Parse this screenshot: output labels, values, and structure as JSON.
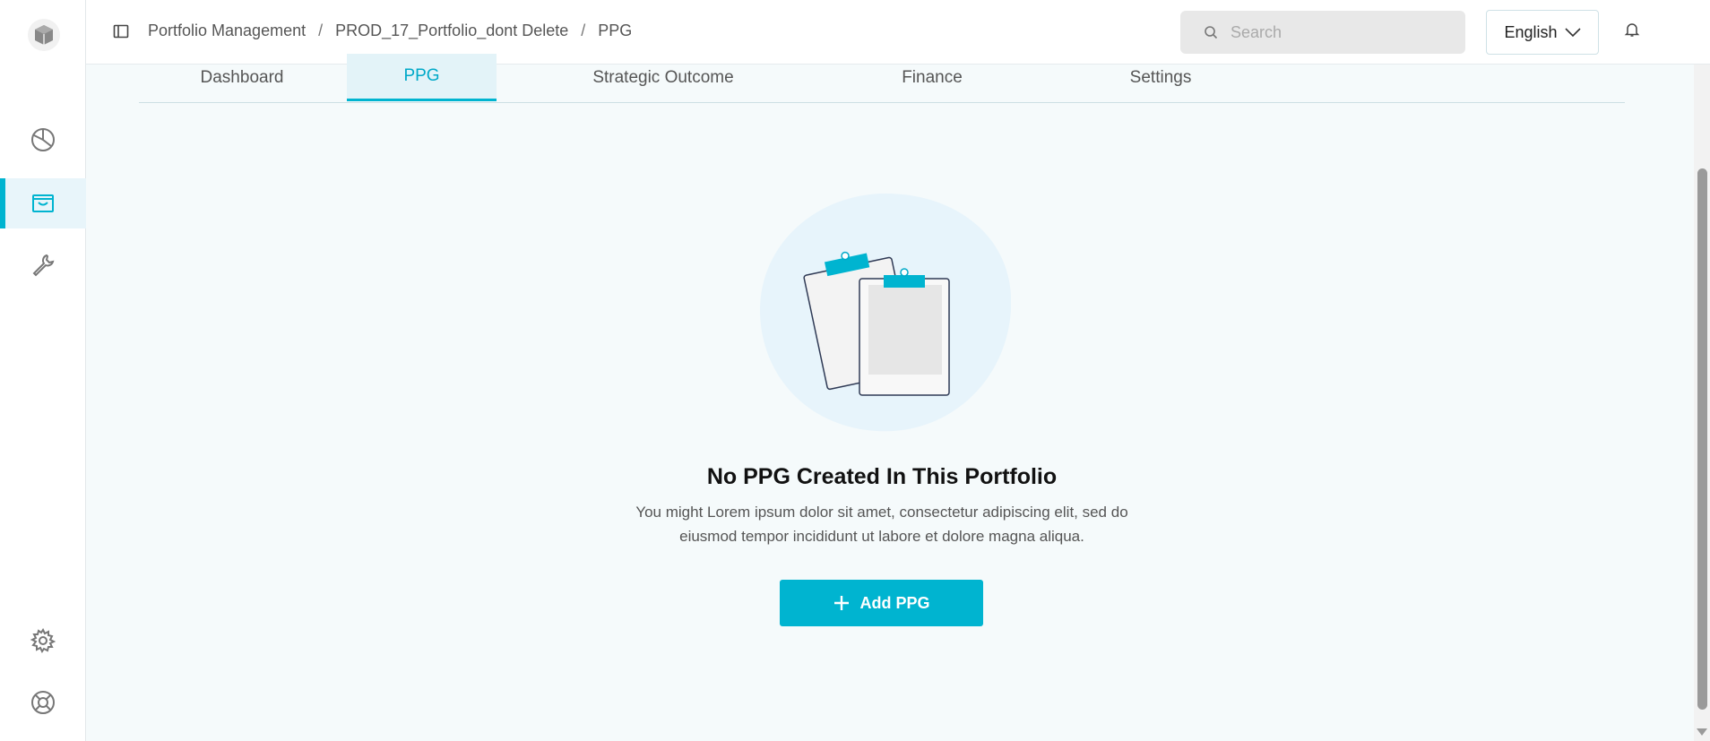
{
  "sidebar": {
    "logo_icon": "cube-logo-icon",
    "items": [
      {
        "icon": "pie-chart-icon",
        "active": false
      },
      {
        "icon": "inbox-icon",
        "active": true
      },
      {
        "icon": "wrench-icon",
        "active": false
      }
    ],
    "bottom_items": [
      {
        "icon": "gear-icon"
      },
      {
        "icon": "lifebuoy-icon"
      }
    ]
  },
  "topbar": {
    "breadcrumb": [
      "Portfolio Management",
      "PROD_17_Portfolio_dont Delete",
      "PPG"
    ],
    "breadcrumb_separator": "/",
    "search_placeholder": "Search",
    "language": "English"
  },
  "tabs": [
    {
      "label": "Dashboard",
      "active": false
    },
    {
      "label": "PPG",
      "active": true
    },
    {
      "label": "Strategic Outcome",
      "active": false
    },
    {
      "label": "Finance",
      "active": false
    },
    {
      "label": "Settings",
      "active": false
    }
  ],
  "empty_state": {
    "title": "No PPG Created In This Portfolio",
    "description": "You might Lorem ipsum dolor sit amet, consectetur adipiscing elit, sed do eiusmod tempor incididunt ut labore et dolore magna aliqua.",
    "button_label": "Add PPG"
  },
  "colors": {
    "accent": "#00b4d0",
    "background": "#f5fafb",
    "active_tab_bg": "#e3f3f8"
  }
}
